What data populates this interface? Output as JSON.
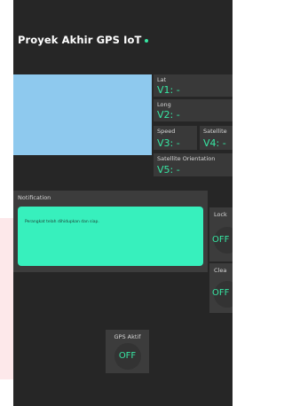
{
  "app": {
    "title": "Proyek Akhir GPS IoT"
  },
  "tiles": {
    "lat": {
      "label": "Lat",
      "value": "V1: -"
    },
    "long": {
      "label": "Long",
      "value": "V2: -"
    },
    "speed": {
      "label": "Speed",
      "value": "V3: -"
    },
    "satellite": {
      "label": "Satellite",
      "value": "V4: -"
    },
    "orientation": {
      "label": "Satellite Orientation",
      "value": "V5: -"
    }
  },
  "notification": {
    "header": "Notification",
    "message": "Perangkat telah dihidupkan dan siap."
  },
  "switches": {
    "lock": {
      "label": "Lock",
      "state": "OFF"
    },
    "clear": {
      "label": "Clea",
      "state": "OFF"
    },
    "gps": {
      "label": "GPS Aktif",
      "state": "OFF"
    }
  },
  "colors": {
    "background": "#262626",
    "accent": "#37e6a3",
    "notification_fill": "#37f0bd",
    "map": "#8ec9ee"
  }
}
